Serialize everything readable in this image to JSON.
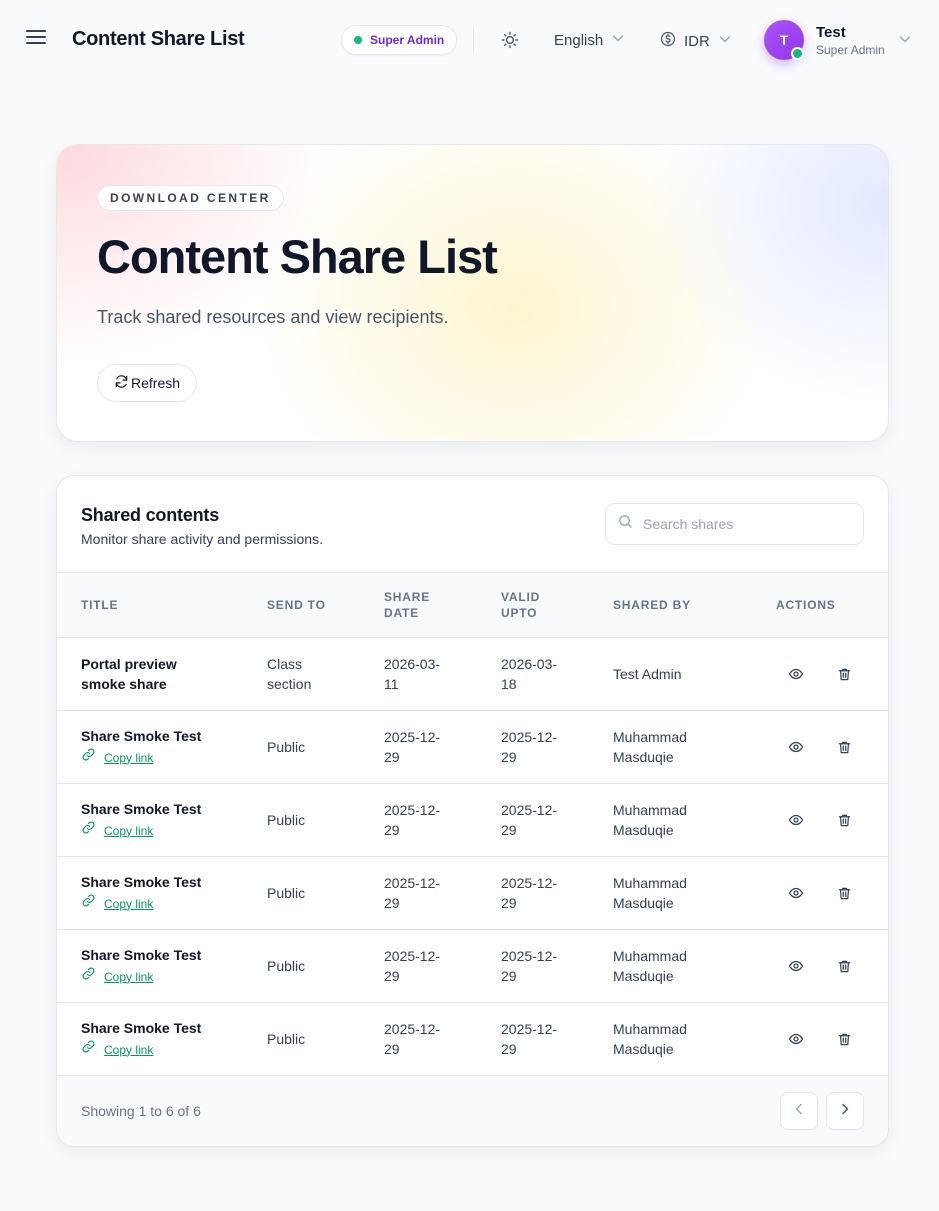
{
  "header": {
    "title": "Content Share List",
    "role_badge": "Super Admin",
    "language": "English",
    "currency": "IDR",
    "user": {
      "initial": "T",
      "name": "Test",
      "role": "Super Admin"
    }
  },
  "hero": {
    "eyebrow": "DOWNLOAD CENTER",
    "title": "Content Share List",
    "subtitle": "Track shared resources and view recipients.",
    "refresh_label": "Refresh"
  },
  "table": {
    "title": "Shared contents",
    "subtitle": "Monitor share activity and permissions.",
    "search_placeholder": "Search shares",
    "columns": {
      "title": "TITLE",
      "send_to": "SEND TO",
      "share_date": "SHARE DATE",
      "valid_upto": "VALID UPTO",
      "shared_by": "SHARED BY",
      "actions": "ACTIONS"
    },
    "copy_link_label": "Copy link",
    "rows": [
      {
        "title": "Portal preview smoke share",
        "send_to": "Class section",
        "share_date": "2026-03-11",
        "valid_upto": "2026-03-18",
        "shared_by": "Test Admin",
        "has_link": false
      },
      {
        "title": "Share Smoke Test",
        "send_to": "Public",
        "share_date": "2025-12-29",
        "valid_upto": "2025-12-29",
        "shared_by": "Muhammad Masduqie",
        "has_link": true
      },
      {
        "title": "Share Smoke Test",
        "send_to": "Public",
        "share_date": "2025-12-29",
        "valid_upto": "2025-12-29",
        "shared_by": "Muhammad Masduqie",
        "has_link": true
      },
      {
        "title": "Share Smoke Test",
        "send_to": "Public",
        "share_date": "2025-12-29",
        "valid_upto": "2025-12-29",
        "shared_by": "Muhammad Masduqie",
        "has_link": true
      },
      {
        "title": "Share Smoke Test",
        "send_to": "Public",
        "share_date": "2025-12-29",
        "valid_upto": "2025-12-29",
        "shared_by": "Muhammad Masduqie",
        "has_link": true
      },
      {
        "title": "Share Smoke Test",
        "send_to": "Public",
        "share_date": "2025-12-29",
        "valid_upto": "2025-12-29",
        "shared_by": "Muhammad Masduqie",
        "has_link": true
      }
    ],
    "footer": "Showing 1 to 6 of 6"
  },
  "colors": {
    "accent": "#6d28d9",
    "success": "#10b981",
    "link": "#059669"
  },
  "icons": {
    "menu": "hamburger-menu-icon",
    "theme": "sun-icon",
    "language": "chevron-down-icon",
    "currency": "dollar-circle-icon",
    "refresh": "refresh-icon",
    "search": "search-icon",
    "link": "link-icon",
    "view": "eye-icon",
    "delete": "trash-icon",
    "prev": "chevron-left-icon",
    "next": "chevron-right-icon"
  }
}
